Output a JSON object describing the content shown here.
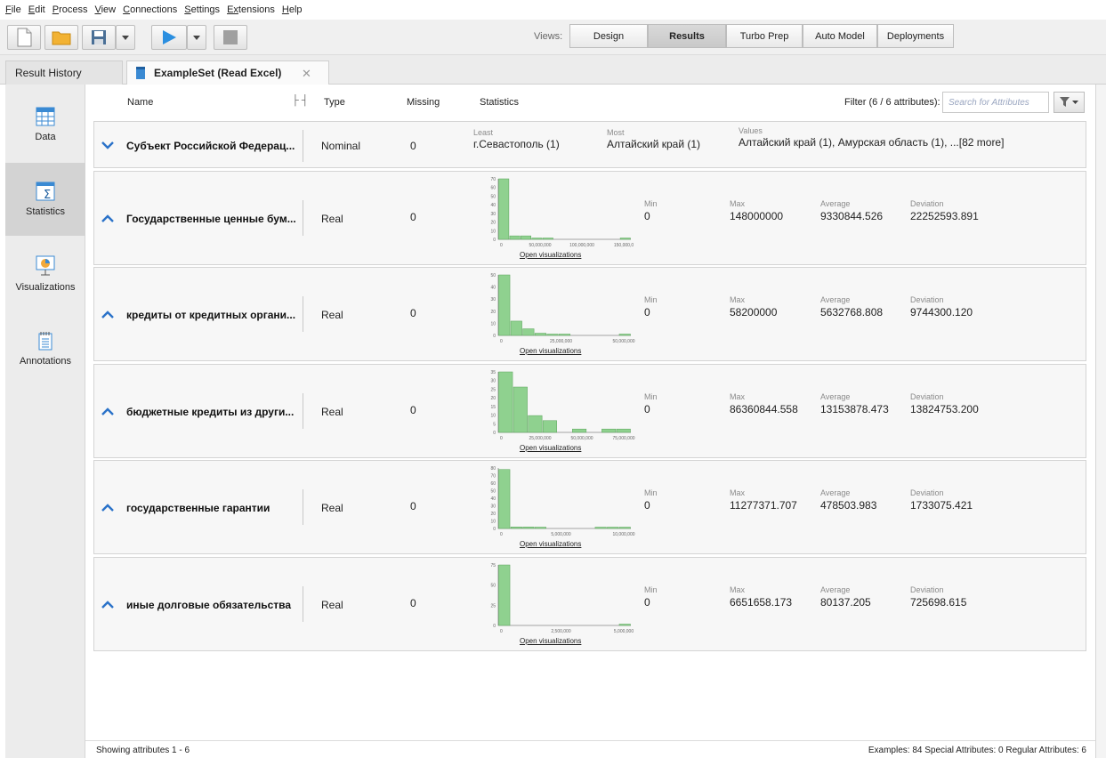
{
  "menu": [
    {
      "u": "F",
      "rest": "ile"
    },
    {
      "u": "E",
      "rest": "dit"
    },
    {
      "u": "P",
      "rest": "rocess"
    },
    {
      "u": "V",
      "rest": "iew"
    },
    {
      "u": "C",
      "rest": "onnections"
    },
    {
      "u": "S",
      "rest": "ettings"
    },
    {
      "u": "Ex",
      "rest": "tensions"
    },
    {
      "u": "H",
      "rest": "elp"
    }
  ],
  "views": {
    "label": "Views:",
    "tabs": [
      "Design",
      "Results",
      "Turbo Prep",
      "Auto Model",
      "Deployments"
    ],
    "active": "Results"
  },
  "tabs": {
    "history": "Result History",
    "exampleset": "ExampleSet (Read Excel)"
  },
  "nav": [
    "Data",
    "Statistics",
    "Visualizations",
    "Annotations"
  ],
  "nav_active": "Statistics",
  "columns": {
    "name": "Name",
    "type": "Type",
    "missing": "Missing",
    "statistics": "Statistics",
    "filter": "Filter (6 / 6 attributes):",
    "search_placeholder": "Search for Attributes"
  },
  "labels": {
    "least": "Least",
    "most": "Most",
    "values": "Values",
    "min": "Min",
    "max": "Max",
    "average": "Average",
    "deviation": "Deviation",
    "open_viz": "Open visualizations"
  },
  "attributes": [
    {
      "name": "Субъект Российской Федерац...",
      "type": "Nominal",
      "missing": "0",
      "least": "г.Севастополь (1)",
      "most": "Алтайский край (1)",
      "values": "Алтайский край (1), Амурская область (1), ...[82 more]"
    },
    {
      "name": "Государственные ценные бум...",
      "type": "Real",
      "missing": "0",
      "min": "0",
      "max": "148000000",
      "average": "9330844.526",
      "deviation": "22252593.891",
      "hist": {
        "y_ticks": [
          "70",
          "60",
          "50",
          "40",
          "30",
          "20",
          "10",
          "0"
        ],
        "y_max": 70,
        "bars": [
          70,
          4,
          4,
          1,
          1,
          0,
          0,
          0,
          0,
          0,
          0,
          1
        ],
        "x_ticks": [
          "0",
          "50,000,000",
          "100,000,000",
          "150,000,0"
        ]
      }
    },
    {
      "name": "кредиты от кредитных органи...",
      "type": "Real",
      "missing": "0",
      "min": "0",
      "max": "58200000",
      "average": "5632768.808",
      "deviation": "9744300.120",
      "hist": {
        "y_ticks": [
          "50",
          "40",
          "30",
          "20",
          "10",
          "0"
        ],
        "y_max": 55,
        "bars": [
          55,
          13,
          6,
          2,
          1,
          1,
          0,
          0,
          0,
          0,
          1
        ],
        "x_ticks": [
          "0",
          "25,000,000",
          "50,000,000"
        ]
      }
    },
    {
      "name": "бюджетные кредиты из други...",
      "type": "Real",
      "missing": "0",
      "min": "0",
      "max": "86360844.558",
      "average": "13153878.473",
      "deviation": "13824753.200",
      "hist": {
        "y_ticks": [
          "35",
          "30",
          "25",
          "20",
          "15",
          "10",
          "5",
          "0"
        ],
        "y_max": 36,
        "bars": [
          36,
          27,
          10,
          7,
          0,
          2,
          0,
          2,
          2
        ],
        "x_ticks": [
          "0",
          "25,000,000",
          "50,000,000",
          "75,000,000"
        ]
      }
    },
    {
      "name": "государственные гарантии",
      "type": "Real",
      "missing": "0",
      "min": "0",
      "max": "11277371.707",
      "average": "478503.983",
      "deviation": "1733075.421",
      "hist": {
        "y_ticks": [
          "80",
          "70",
          "60",
          "50",
          "40",
          "30",
          "20",
          "10",
          "0"
        ],
        "y_max": 80,
        "bars": [
          78,
          2,
          2,
          1,
          0,
          0,
          0,
          0,
          1,
          1,
          1
        ],
        "x_ticks": [
          "0",
          "5,000,000",
          "10,000,000"
        ]
      }
    },
    {
      "name": "иные долговые обязательства",
      "type": "Real",
      "missing": "0",
      "min": "0",
      "max": "6651658.173",
      "average": "80137.205",
      "deviation": "725698.615",
      "hist": {
        "y_ticks": [
          "75",
          "50",
          "25",
          "0"
        ],
        "y_max": 83,
        "bars": [
          83,
          0,
          0,
          0,
          0,
          0,
          0,
          0,
          0,
          0,
          1
        ],
        "x_ticks": [
          "0",
          "2,500,000",
          "5,000,000"
        ]
      }
    }
  ],
  "status": {
    "left": "Showing attributes 1 - 6",
    "right": "Examples: 84   Special Attributes: 0   Regular Attributes: 6"
  },
  "colors": {
    "bar_fill": "#8fd18f",
    "bar_stroke": "#5aa35a",
    "chevron": "#2a72c9",
    "play": "#2b8fe0"
  }
}
